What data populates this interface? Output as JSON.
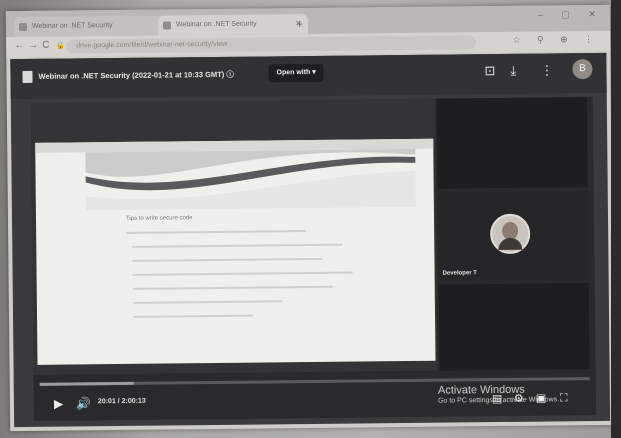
{
  "browser": {
    "tabs": [
      {
        "label": "Webinar on .NET Security"
      },
      {
        "label": "Webinar on .NET Security"
      }
    ],
    "new_tab_glyph": "+",
    "window_controls": "– ▢ ✕",
    "url": "drive.google.com/file/d/webinar-net-security/view",
    "nav": {
      "back": "←",
      "forward": "→",
      "reload": "C",
      "lock": "🔒"
    },
    "extensions": "☆ ⚲ ⊕ ⋮"
  },
  "player": {
    "title": "Webinar on .NET Security (2022-01-21 at 10:33 GMT) ⓘ",
    "open_with": "Open with ▾",
    "header_icons": {
      "comment": "comment-icon",
      "download": "download-icon",
      "more": "more-vert-icon"
    },
    "avatar_initial": "B",
    "slide_heading": "Tips to write secure code",
    "participant_name": "Developer T",
    "time": "20:01 / 2:00:13",
    "progress": 0.17,
    "accent_color": "#323234"
  },
  "os": {
    "watermark_title": "Activate Windows",
    "watermark_sub": "Go to PC settings to activate Windows."
  }
}
